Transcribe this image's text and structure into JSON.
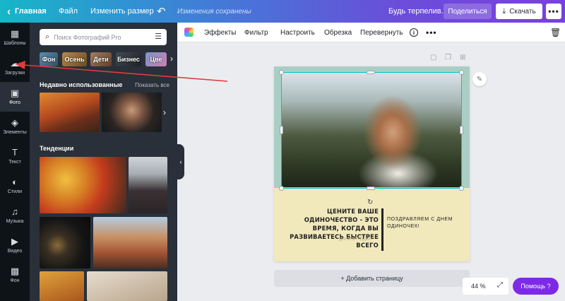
{
  "topbar": {
    "home_label": "Главная",
    "file_label": "Файл",
    "resize_label": "Изменить размер",
    "saved_status": "Изменения сохранены",
    "patience_label": "Будь терпелив.",
    "share_label": "Поделиться",
    "download_label": "Скачать"
  },
  "rail": {
    "items": [
      {
        "label": "Шаблоны",
        "icon": "templates-icon"
      },
      {
        "label": "Загрузки",
        "icon": "upload-cloud-icon"
      },
      {
        "label": "Фото",
        "icon": "photo-icon"
      },
      {
        "label": "Элементы",
        "icon": "elements-icon"
      },
      {
        "label": "Текст",
        "icon": "text-icon"
      },
      {
        "label": "Стили",
        "icon": "palette-icon"
      },
      {
        "label": "Музыка",
        "icon": "music-icon"
      },
      {
        "label": "Видео",
        "icon": "video-icon"
      },
      {
        "label": "Фон",
        "icon": "background-icon"
      }
    ]
  },
  "panel": {
    "search_placeholder": "Поиск Фотографий Pro",
    "chips": [
      "Фон",
      "Осень",
      "Дети",
      "Бизнес",
      "Цве"
    ],
    "recent_title": "Недавно использованные",
    "show_all": "Показать все",
    "trends_title": "Тенденции"
  },
  "image_toolbar": {
    "effects": "Эффекты",
    "filter": "Фильтр",
    "adjust": "Настроить",
    "crop": "Обрезка",
    "flip": "Перевернуть"
  },
  "design": {
    "quote": "ЦЕНИТЕ ВАШЕ ОДИНОЧЕСТВО - ЭТО ВРЕМЯ, КОГДА ВЫ РАЗВИВАЕТЕСЬ БЫСТРЕЕ ВСЕГО",
    "author": "ДАНИЭЛ ГОДИЛ",
    "congrats": "ПОЗДРАВЛЯЕМ С ДНЕМ ОДИНОЧЕК!"
  },
  "canvas": {
    "add_page": "+ Добавить страницу",
    "zoom": "44 %",
    "help": "Помощь ?"
  },
  "colors": {
    "accent_purple": "#7d2ae8",
    "selection": "#00c4cc",
    "annotation_arrow": "#e23b3b"
  }
}
